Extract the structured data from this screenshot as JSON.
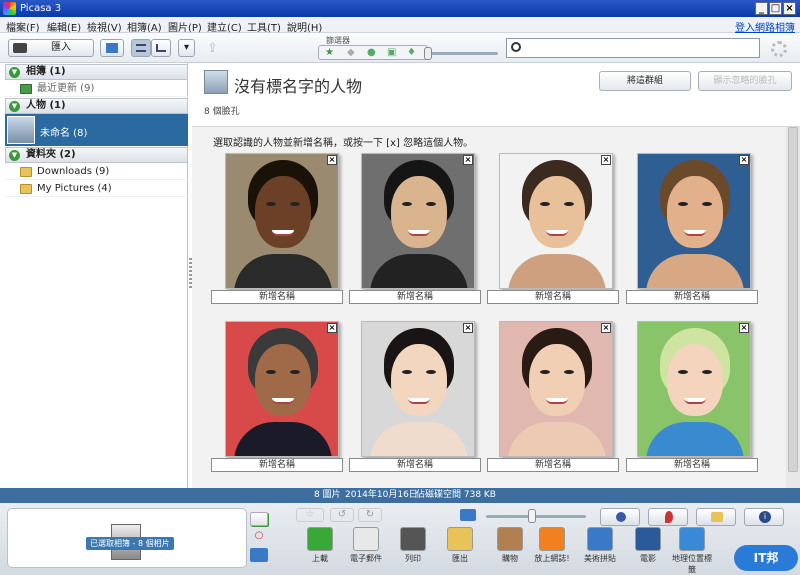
{
  "window": {
    "title": "Picasa 3"
  },
  "menu": {
    "items": [
      "檔案(F)",
      "編輯(E)",
      "檢視(V)",
      "相簿(A)",
      "圖片(P)",
      "建立(C)",
      "工具(T)",
      "說明(H)"
    ],
    "login": "登入網路相簿"
  },
  "toolbar": {
    "import_label": "匯入",
    "filter_label": "篩選器"
  },
  "search": {
    "placeholder": ""
  },
  "sidebar": {
    "albums": {
      "title": "相簿 (1)",
      "items": [
        {
          "label": "最近更新 (9)"
        }
      ]
    },
    "people": {
      "title": "人物 (1)",
      "selected": "未命名 (8)"
    },
    "folders": {
      "title": "資料夾 (2)",
      "items": [
        {
          "label": "Downloads (9)"
        },
        {
          "label": "My Pictures (4)"
        }
      ]
    }
  },
  "main": {
    "title": "沒有標名字的人物",
    "faces_count": "8 個臉孔",
    "btn_group": "將這群組",
    "btn_show": "顯示忽略的臉孔",
    "instruction": "選取認識的人物並新增名稱，或按一下 [x] 忽略這個人物。",
    "add_name": "新增名稱",
    "faces": [
      {
        "skin": "#6b4026",
        "hair": "#1a1208",
        "bg": "#9a8a70",
        "body": "#2a2a2a"
      },
      {
        "skin": "#d9b48e",
        "hair": "#151515",
        "bg": "#6f6f6f",
        "body": "#222222"
      },
      {
        "skin": "#e8c09a",
        "hair": "#3a2a20",
        "bg": "#f2f2f2",
        "body": "#cfa080"
      },
      {
        "skin": "#e2b08a",
        "hair": "#6a4a2a",
        "bg": "#2f5f92",
        "body": "#d8a884"
      },
      {
        "skin": "#a06a48",
        "hair": "#3a3a3a",
        "bg": "#d84a4a",
        "body": "#1a1a28"
      },
      {
        "skin": "#f2d6c0",
        "hair": "#1a1414",
        "bg": "#d8d8d8",
        "body": "#f0dccc"
      },
      {
        "skin": "#f0cfb4",
        "hair": "#2a1a14",
        "bg": "#e0b8b0",
        "body": "#eccab4"
      },
      {
        "skin": "#f4d4bc",
        "hair": "#cfe4a0",
        "bg": "#8ac46a",
        "body": "#3a8ad0"
      }
    ]
  },
  "status": {
    "count": "8 圖片",
    "date": "2014年10月16日",
    "disk": "佔磁碟空間 738 KB"
  },
  "tray": {
    "label": "已選取相簿 - 8 個相片"
  },
  "bottom_tools": [
    {
      "label": "上載",
      "color": "#38a838"
    },
    {
      "label": "電子郵件",
      "color": "#e8e8e8"
    },
    {
      "label": "列印",
      "color": "#555555"
    },
    {
      "label": "匯出",
      "color": "#e8c35a"
    },
    {
      "label": "購物",
      "color": "#b08050"
    },
    {
      "label": "放上網誌!",
      "color": "#f08020"
    },
    {
      "label": "美術拼貼",
      "color": "#3a78c8"
    },
    {
      "label": "電影",
      "color": "#2a5a9a"
    },
    {
      "label": "地理位置標籤",
      "color": "#3a88d8"
    }
  ],
  "watermark": "IT邦"
}
